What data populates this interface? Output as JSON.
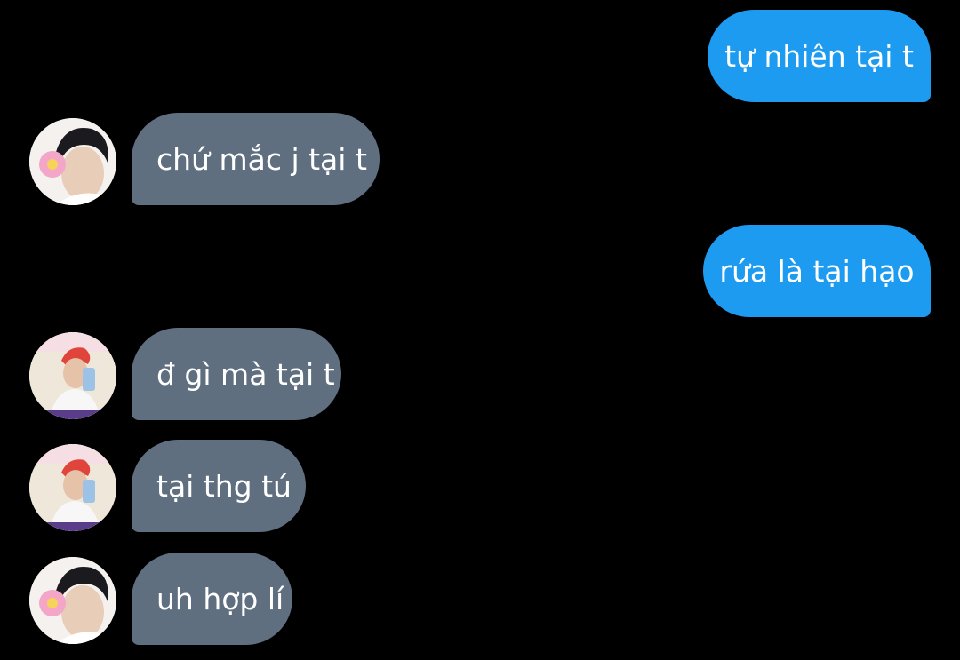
{
  "colors": {
    "background": "#000000",
    "outgoing_bubble": "#1d9bf0",
    "incoming_bubble": "#5f6f7f",
    "text": "#ffffff"
  },
  "messages": [
    {
      "direction": "outgoing",
      "text": "tự nhiên tại t"
    },
    {
      "direction": "incoming",
      "avatar": "avatar-dark-hair-flower",
      "text": "chứ mắc j tại t"
    },
    {
      "direction": "outgoing",
      "text": "rứa là tại hạo"
    },
    {
      "direction": "incoming",
      "avatar": "avatar-red-hair-phone",
      "text": "đ gì mà tại t"
    },
    {
      "direction": "incoming",
      "avatar": "avatar-red-hair-phone",
      "text": "tại thg tú"
    },
    {
      "direction": "incoming",
      "avatar": "avatar-dark-hair-flower",
      "text": "uh hợp lí"
    }
  ]
}
